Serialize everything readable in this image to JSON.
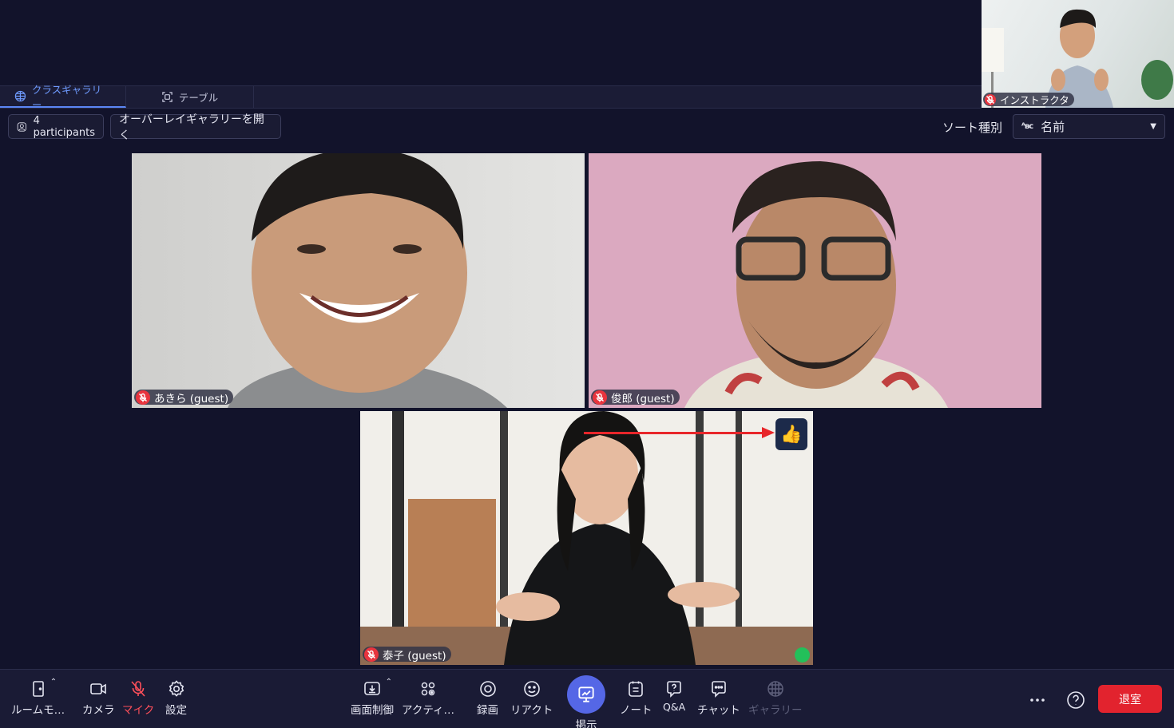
{
  "tabs": [
    {
      "label": "クラスギャラリー",
      "active": true,
      "icon": "globe-grid-icon"
    },
    {
      "label": "テーブル",
      "active": false,
      "icon": "table-frame-icon"
    }
  ],
  "instructor": {
    "label": "インストラクタ"
  },
  "controls": {
    "participants_label": "4 participants",
    "overlay_gallery_label": "オーバーレイギャラリーを開く",
    "sort_label": "ソート種別",
    "sort_value": "名前"
  },
  "tiles": [
    {
      "name": "あきら (guest)"
    },
    {
      "name": "俊郎 (guest)"
    },
    {
      "name": "泰子 (guest)",
      "reaction": "👍"
    }
  ],
  "toolbar": {
    "room_mode": "ルームモ…",
    "camera": "カメラ",
    "mic": "マイク",
    "settings": "設定",
    "screen_control": "画面制御",
    "activity": "アクティ…",
    "record": "録画",
    "react": "リアクト",
    "present": "掲示",
    "notes": "ノート",
    "qa": "Q&A",
    "chat": "チャット",
    "gallery": "ギャラリー",
    "leave": "退室"
  },
  "colors": {
    "background": "#12132b",
    "accent": "#5567e6",
    "leave": "#e2232e",
    "mic_off": "#e8343e"
  }
}
